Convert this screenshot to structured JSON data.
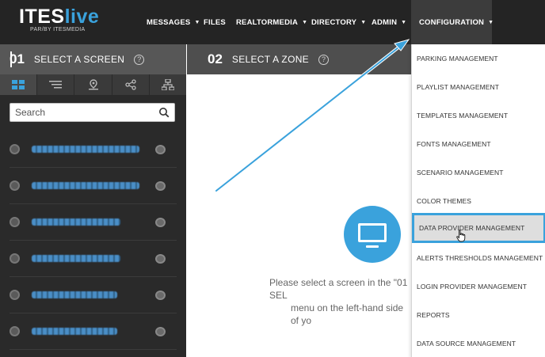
{
  "brand": {
    "name_part1": "ITES",
    "name_part2": "live",
    "tagline": "PAR/BY ITESMEDIA",
    "accent": "#3aa2dc"
  },
  "nav": {
    "messages": "MESSAGES",
    "files": "FILES",
    "realtormedia": "REALTORMEDIA",
    "directory": "DIRECTORY",
    "admin": "ADMIN",
    "configuration": "CONFIGURATION",
    "caret": "▼"
  },
  "select_screen": {
    "number": "01",
    "title": "SELECT A SCREEN",
    "help": "?"
  },
  "view_tabs": [
    "grid-icon",
    "filter-list-icon",
    "location-icon",
    "share-icon",
    "hierarchy-icon"
  ],
  "search": {
    "placeholder": "Search",
    "value": ""
  },
  "screens": [
    {
      "label": "",
      "status_icon": "screen-status-icon"
    },
    {
      "label": "",
      "status_icon": "screen-status-icon"
    },
    {
      "label": "",
      "status_icon": "screen-status-icon"
    },
    {
      "label": "",
      "status_icon": "screen-status-icon"
    },
    {
      "label": "",
      "status_icon": "screen-status-icon"
    },
    {
      "label": "",
      "status_icon": "screen-status-icon"
    }
  ],
  "select_zone": {
    "number": "02",
    "title": "SELECT A ZONE",
    "help": "?"
  },
  "zone_message": {
    "line1": "Please select a screen in the \"01 SEL",
    "line2": "menu on the left-hand side of yo"
  },
  "configuration_menu": [
    "PARKING MANAGEMENT",
    "PLAYLIST MANAGEMENT",
    "TEMPLATES MANAGEMENT",
    "FONTS MANAGEMENT",
    "SCENARIO MANAGEMENT",
    "COLOR THEMES",
    "DATA PROVIDER MANAGEMENT",
    "ALERTS THRESHOLDS MANAGEMENT",
    "LOGIN PROVIDER MANAGEMENT",
    "REPORTS",
    "DATA SOURCE MANAGEMENT"
  ],
  "highlighted_menu_item": "DATA PROVIDER MANAGEMENT"
}
